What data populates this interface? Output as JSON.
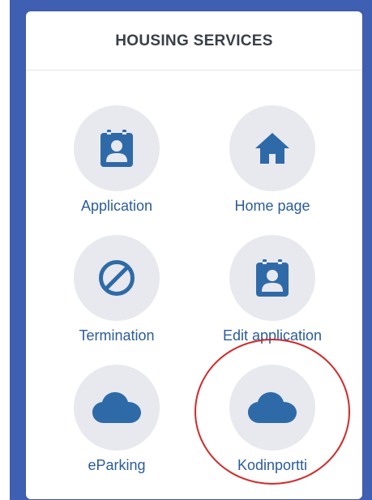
{
  "panel": {
    "title": "HOUSING SERVICES"
  },
  "services": [
    {
      "label": "Application",
      "icon": "calendar-user-icon"
    },
    {
      "label": "Home page",
      "icon": "home-icon"
    },
    {
      "label": "Termination",
      "icon": "prohibited-icon"
    },
    {
      "label": "Edit application",
      "icon": "calendar-user-icon"
    },
    {
      "label": "eParking",
      "icon": "cloud-icon"
    },
    {
      "label": "Kodinportti",
      "icon": "cloud-icon"
    }
  ],
  "colors": {
    "accent": "#2b5c9e",
    "icon": "#2f6aa8",
    "tile_background": "#e7e9ee",
    "frame": "#3f5fb2",
    "annotation": "#d22a2a"
  }
}
